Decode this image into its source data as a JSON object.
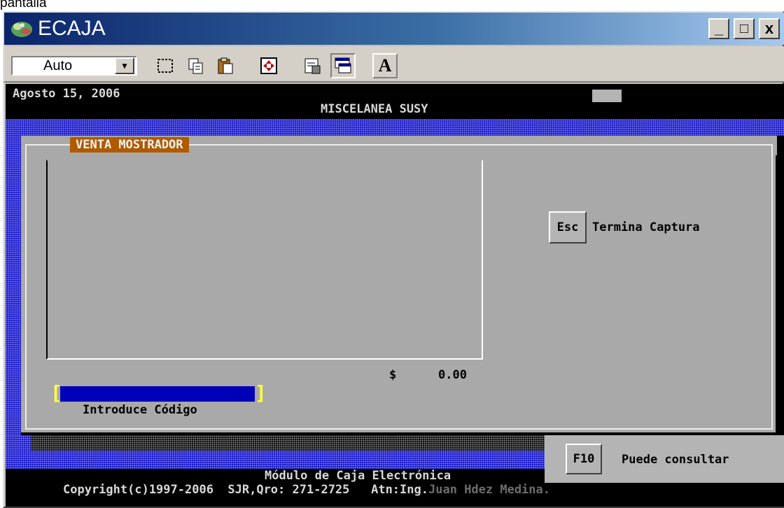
{
  "background_caption": "pantalla",
  "window": {
    "title": "ECAJA",
    "controls": {
      "minimize": "_",
      "maximize": "□",
      "close": "x"
    }
  },
  "toolbar": {
    "font_size_value": "Auto",
    "buttons": [
      "mark-icon",
      "copy-icon",
      "paste-icon",
      "fullscreen-icon",
      "properties-icon",
      "background-icon",
      "font-icon"
    ],
    "font_button_label": "A"
  },
  "console": {
    "date": "Agosto 15, 2006",
    "store_name": "MISCELANEA SUSY",
    "section_title": "VENTA MOSTRADOR",
    "esc_key": "Esc",
    "esc_label": "Termina Captura",
    "currency": "$",
    "total": "0.00",
    "input_label": "Introduce Código",
    "f10_key": "F10",
    "f10_label": "Puede consultar",
    "footer_line1": "Módulo de Caja Electrónica",
    "footer_line2_a": "Copyright(c)1997-2006  SJR,Qro: 271-2725   Atn:Ing.",
    "footer_line2_b": "Juan Hdez Medina."
  },
  "colors": {
    "console_bg": "#000000",
    "panel_gray": "#a9a9a9",
    "section_tag": "#b05a00",
    "input_blue": "#0000b8",
    "dither_blue": "#1c1cc8"
  }
}
